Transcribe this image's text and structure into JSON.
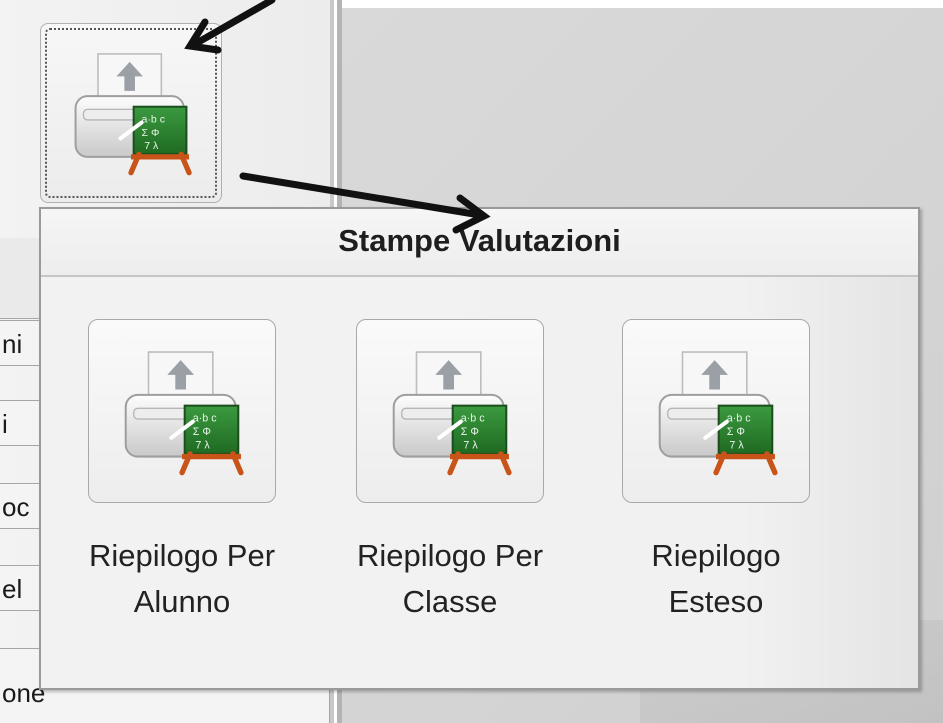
{
  "popup": {
    "title": "Stampe Valutazioni",
    "items": [
      {
        "line1": "Riepilogo Per",
        "line2": "Alunno",
        "icon": "print-grades-icon"
      },
      {
        "line1": "Riepilogo Per",
        "line2": "Classe",
        "icon": "print-grades-icon"
      },
      {
        "line1": "Riepilogo",
        "line2": "Esteso",
        "icon": "print-grades-icon"
      }
    ]
  },
  "toolbar": {
    "button_icon": "print-grades-icon"
  },
  "left_menu": {
    "fragments": [
      "ni",
      "i",
      "oc",
      "el",
      "one"
    ]
  },
  "colors": {
    "arrow": "#111111",
    "chalkboard": "#2e7d32",
    "easel": "#c9541a",
    "printer": "#e8e8e8",
    "paper_arrow": "#9aa0a6"
  }
}
